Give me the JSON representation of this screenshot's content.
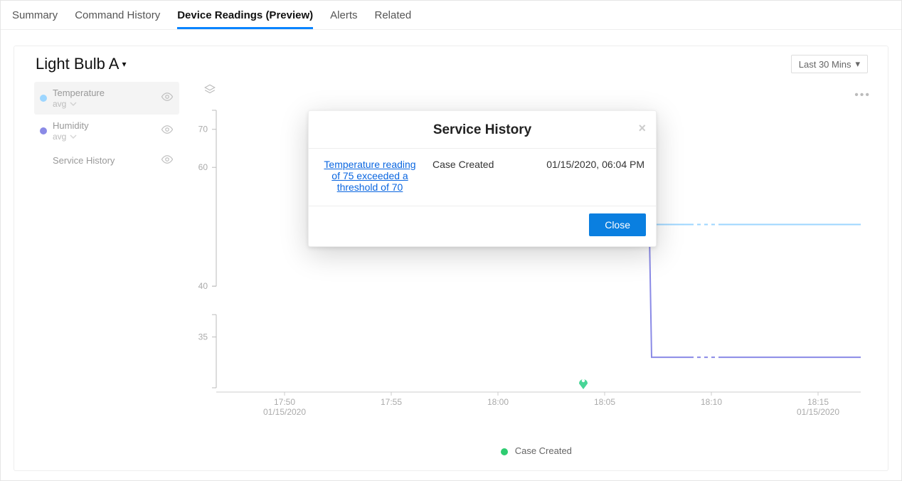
{
  "tabs": [
    "Summary",
    "Command History",
    "Device Readings (Preview)",
    "Alerts",
    "Related"
  ],
  "active_tab": 2,
  "title": "Light Bulb A",
  "range_label": "Last 30 Mins",
  "side_items": [
    {
      "label": "Temperature",
      "sub": "avg",
      "dot": "#9dd6ff"
    },
    {
      "label": "Humidity",
      "sub": "avg",
      "dot": "#8a8ae6"
    },
    {
      "label": "Service History",
      "sub": "",
      "dot": ""
    }
  ],
  "bottom_legend": "Case Created",
  "modal": {
    "title": "Service History",
    "link": "Temperature reading of 75 exceeded a threshold of 70",
    "status": "Case Created",
    "time": "01/15/2020, 06:04 PM",
    "close_btn": "Close"
  },
  "chart_data": {
    "type": "line",
    "xlabel": "",
    "ylabel": "",
    "x_ticks": [
      {
        "label": "17:50",
        "sub": "01/15/2020"
      },
      {
        "label": "17:55",
        "sub": ""
      },
      {
        "label": "18:00",
        "sub": ""
      },
      {
        "label": "18:05",
        "sub": ""
      },
      {
        "label": "18:10",
        "sub": ""
      },
      {
        "label": "18:15",
        "sub": "01/15/2020"
      }
    ],
    "y_ticks": [
      70,
      60,
      40,
      35
    ],
    "ylim": [
      30,
      75
    ],
    "xlim": [
      "17:47",
      "18:17"
    ],
    "series": [
      {
        "name": "Temperature",
        "color": "#9dd6ff",
        "style": "solid",
        "points": [
          {
            "x": "18:07",
            "y": 45
          },
          {
            "x": "18:09",
            "y": 45
          }
        ]
      },
      {
        "name": "Temperature (projected)",
        "color": "#9dd6ff",
        "style": "dashed",
        "points": [
          {
            "x": "18:09",
            "y": 45
          },
          {
            "x": "18:10.5",
            "y": 45
          }
        ]
      },
      {
        "name": "Temperature tail",
        "color": "#9dd6ff",
        "style": "solid",
        "points": [
          {
            "x": "18:10.5",
            "y": 45
          },
          {
            "x": "18:17",
            "y": 45
          }
        ]
      },
      {
        "name": "Humidity",
        "color": "#8a8ae6",
        "style": "solid",
        "points": [
          {
            "x": "18:06",
            "y": 74
          },
          {
            "x": "18:07",
            "y": 74
          },
          {
            "x": "18:07.2",
            "y": 33
          },
          {
            "x": "18:09",
            "y": 33
          }
        ]
      },
      {
        "name": "Humidity (projected)",
        "color": "#8a8ae6",
        "style": "dashed",
        "points": [
          {
            "x": "18:09",
            "y": 33
          },
          {
            "x": "18:10.5",
            "y": 33
          }
        ]
      },
      {
        "name": "Humidity tail",
        "color": "#8a8ae6",
        "style": "solid",
        "points": [
          {
            "x": "18:10.5",
            "y": 33
          },
          {
            "x": "18:17",
            "y": 33
          }
        ]
      }
    ],
    "events": [
      {
        "x": "18:04",
        "label": "Case Created",
        "color": "#48d597"
      }
    ],
    "colors": {
      "temperature": "#9dd6ff",
      "humidity": "#8a8ae6",
      "event": "#48d597"
    }
  }
}
